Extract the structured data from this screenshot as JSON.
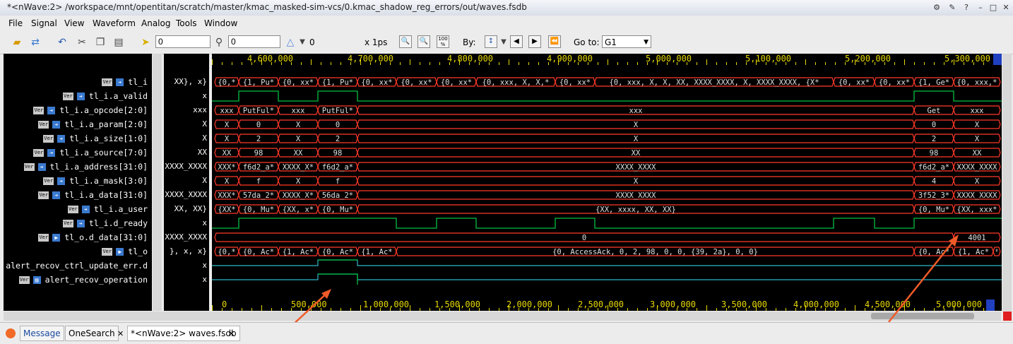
{
  "window": {
    "title": "*<nWave:2> /workspace/mnt/opentitan/scratch/master/kmac_masked-sim-vcs/0.kmac_shadow_reg_errors/out/waves.fsdb"
  },
  "menu": [
    "File",
    "Signal",
    "View",
    "Waveform",
    "Analog",
    "Tools",
    "Window"
  ],
  "toolbar": {
    "cursor_time": "0",
    "marker_time": "0",
    "delta": "0",
    "time_unit": "x 1ps",
    "by_label": "By:",
    "goto_label": "Go to:",
    "goto_value": "G1",
    "zoom_pct_icon": "100 %"
  },
  "signals": [
    {
      "name": "tl_i",
      "value": "XX}, x}",
      "ar": "in"
    },
    {
      "name": "tl_i.a_valid",
      "value": "x",
      "ar": "in"
    },
    {
      "name": "tl_i.a_opcode[2:0]",
      "value": "xxx",
      "ar": "in"
    },
    {
      "name": "tl_i.a_param[2:0]",
      "value": "X",
      "ar": "in"
    },
    {
      "name": "tl_i.a_size[1:0]",
      "value": "X",
      "ar": "in"
    },
    {
      "name": "tl_i.a_source[7:0]",
      "value": "XX",
      "ar": "in"
    },
    {
      "name": "tl_i.a_address[31:0]",
      "value": "XXXX_XXXX",
      "ar": "in"
    },
    {
      "name": "tl_i.a_mask[3:0]",
      "value": "X",
      "ar": "in"
    },
    {
      "name": "tl_i.a_data[31:0]",
      "value": "XXXX_XXXX",
      "ar": "in"
    },
    {
      "name": "tl_i.a_user",
      "value": "XX, XX}",
      "ar": "in"
    },
    {
      "name": "tl_i.d_ready",
      "value": "x",
      "ar": "in"
    },
    {
      "name": "tl_o.d_data[31:0]",
      "value": "XXXX_XXXX",
      "ar": "out"
    },
    {
      "name": "tl_o",
      "value": "}, x, x}",
      "ar": "out"
    },
    {
      "name": "alert_recov_ctrl_update_err.d",
      "value": "x",
      "ar": "none"
    },
    {
      "name": "alert_recov_operation",
      "value": "x",
      "ar": "reg"
    }
  ],
  "ruler_top": [
    "4,600,000",
    "4,700,000",
    "4,800,000",
    "4,900,000",
    "5,000,000",
    "5,100,000",
    "5,200,000",
    "5,300,000"
  ],
  "ruler_bottom": [
    "0",
    "500,000",
    "1,000,000",
    "1,500,000",
    "2,000,000",
    "2,500,000",
    "3,000,000",
    "3,500,000",
    "4,000,000",
    "4,500,000",
    "5,000,000"
  ],
  "waves": {
    "tl_i": [
      "{0,*",
      "{1, Pu*",
      "{0, xx*",
      "{1, Pu*",
      "{0, xx*",
      "{0, xx*",
      "{0, xx*",
      "{0, xxx, X, X,*",
      "{0, xx*",
      "{0, xxx, X, X, XX, XXXX_XXXX, X, XXXX_XXXX, {X*",
      "{0, xx*",
      "{0, xx*",
      "{1, Ge*",
      "{0, xxx,*"
    ],
    "a_opcode": [
      "xxx",
      "PutFul*",
      "xxx",
      "PutFul*",
      "xxx",
      "Get",
      "xxx"
    ],
    "a_param": [
      "X",
      "0",
      "X",
      "0",
      "X",
      "0",
      "X"
    ],
    "a_size": [
      "X",
      "2",
      "X",
      "2",
      "X",
      "2",
      "X"
    ],
    "a_source": [
      "XX",
      "98",
      "XX",
      "98",
      "XX",
      "98",
      "XX"
    ],
    "a_address": [
      "XXX*",
      "f6d2_a*",
      "XXXX_X*",
      "f6d2_a*",
      "XXXX_XXXX",
      "f6d2_a*",
      "XXXX_XXXX"
    ],
    "a_mask": [
      "X",
      "f",
      "X",
      "f",
      "X",
      "4",
      "X"
    ],
    "a_data": [
      "XXX*",
      "57da_2*",
      "XXXX_X*",
      "56da_2*",
      "XXXX_XXXX",
      "3f52_3*",
      "XXXX_XXXX"
    ],
    "a_user": [
      "{XX*",
      "{0, Mu*",
      "{XX, x*",
      "{0, Mu*",
      "{XX, xxxx, XX, XX}",
      "{0, Mu*",
      "{XX, xxx*"
    ],
    "d_data": [
      "0",
      "4001"
    ],
    "tl_o": [
      "{0,*",
      "{0, Ac*",
      "{1, Ac*",
      "{0, Ac*",
      "{1, Ac*",
      "{0, AccessAck, 0, 2, 98, 0, 0, {39, 2a}, 0, 0}",
      "{0, Ac*",
      "{1, Ac*",
      "*"
    ]
  },
  "bottom_tabs": [
    "Message",
    "OneSearch",
    "*<nWave:2> waves.fsdb"
  ],
  "colors": {
    "bus": "#ff3a2a",
    "bit": "#00c040",
    "x": "#2fb8c8",
    "text": "#e0e0e0",
    "ruler": "#e6d800",
    "arrow": "#f05a28"
  }
}
